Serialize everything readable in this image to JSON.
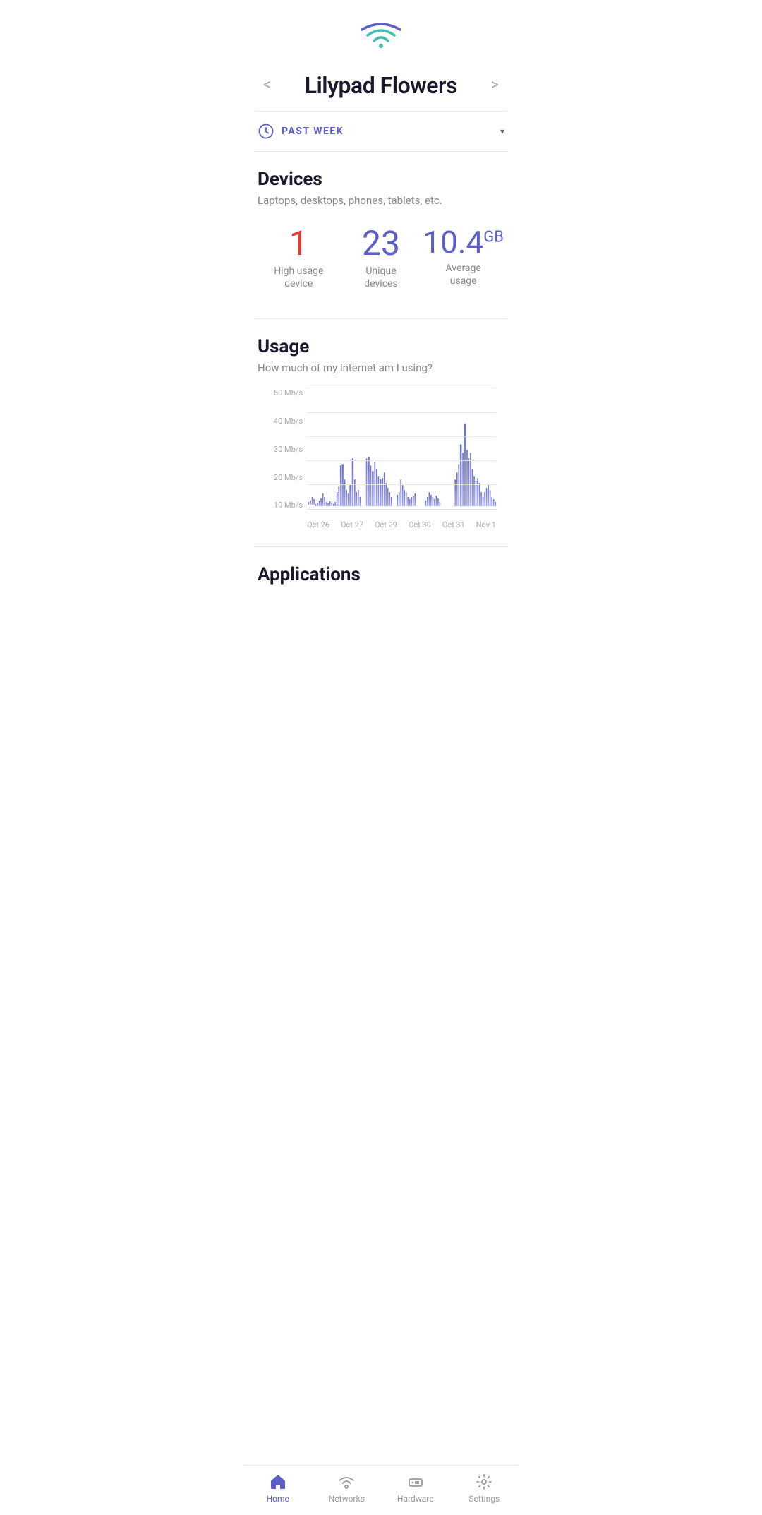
{
  "header": {
    "title": "Lilypad Flowers",
    "prev_label": "<",
    "next_label": ">"
  },
  "time_filter": {
    "label": "PAST WEEK",
    "dropdown_icon": "▾"
  },
  "devices": {
    "section_title": "Devices",
    "section_subtitle": "Laptops, desktops, phones, tablets, etc.",
    "stats": [
      {
        "value": "1",
        "label": "High usage\ndevice",
        "color": "red"
      },
      {
        "value": "23",
        "label": "Unique\ndevices",
        "color": "blue"
      },
      {
        "value": "10.4",
        "unit": "GB",
        "label": "Average\nusage",
        "color": "blue"
      }
    ]
  },
  "usage": {
    "section_title": "Usage",
    "section_subtitle": "How much of my internet am I using?",
    "y_labels": [
      "10 Mb/s",
      "20 Mb/s",
      "30 Mb/s",
      "40 Mb/s",
      "50 Mb/s"
    ],
    "x_labels": [
      "Oct 26",
      "Oct 27",
      "Oct 29",
      "Oct 30",
      "Oct 31",
      "Nov 1"
    ]
  },
  "applications": {
    "section_title": "Applications"
  },
  "nav": {
    "items": [
      {
        "id": "home",
        "label": "Home",
        "active": true
      },
      {
        "id": "networks",
        "label": "Networks",
        "active": false
      },
      {
        "id": "hardware",
        "label": "Hardware",
        "active": false
      },
      {
        "id": "settings",
        "label": "Settings",
        "active": false
      }
    ]
  }
}
